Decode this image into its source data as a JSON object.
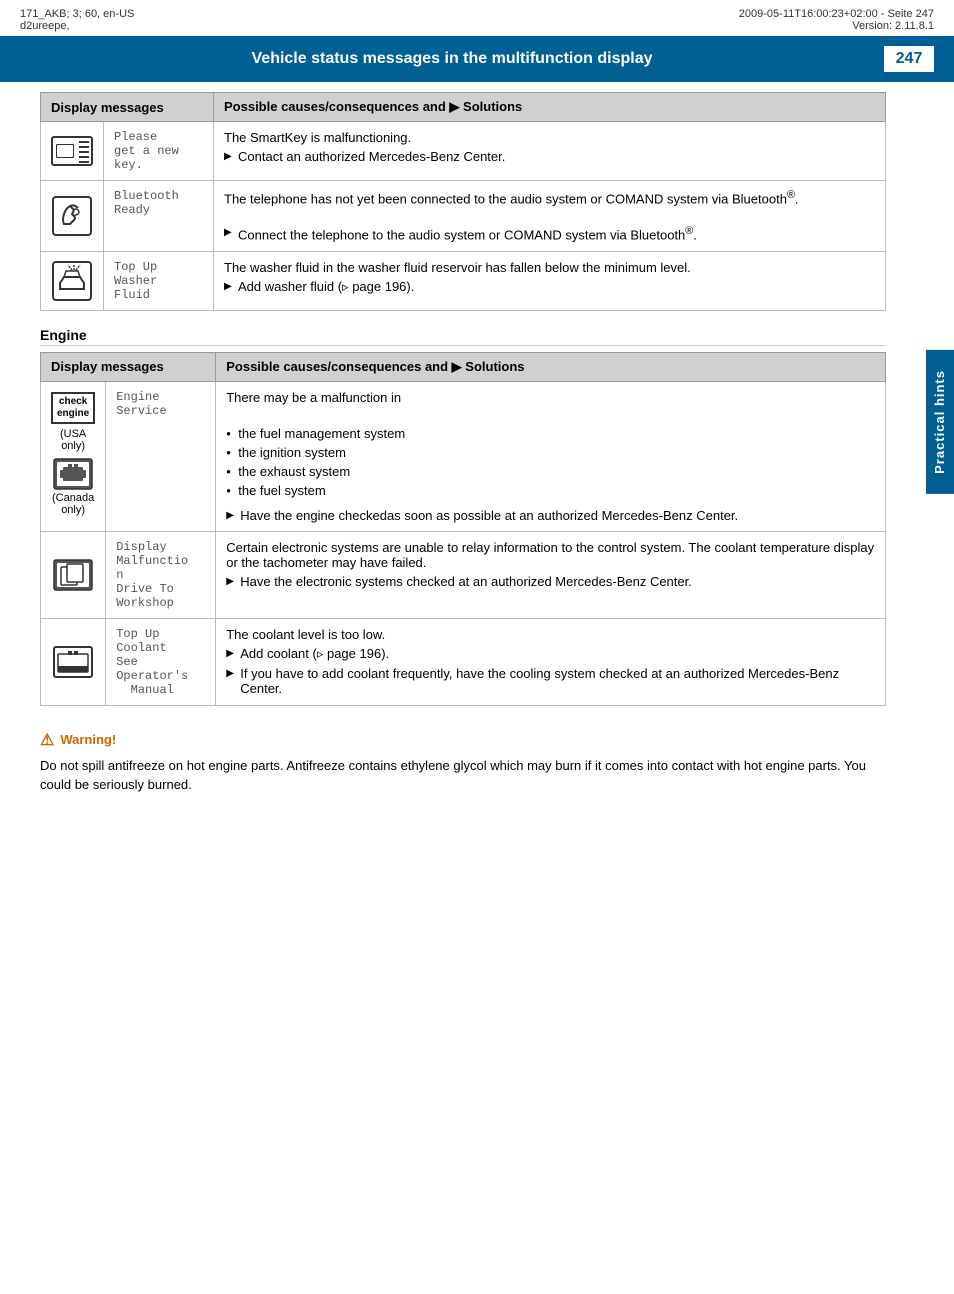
{
  "meta": {
    "left": "171_AKB; 3; 60, en-US\nd2ureepe,",
    "right": "2009-05-11T16:00:23+02:00 - Seite 247\nVersion: 2.11.8.1"
  },
  "page_title": "Vehicle status messages in the multifunction display",
  "page_number": "247",
  "right_tab_label": "Practical hints",
  "table1": {
    "header_col1": "Display messages",
    "header_col2": "Possible causes/consequences and ▶ Solutions",
    "rows": [
      {
        "display_msg": "Please\nget a new\nkey.",
        "causes": "The SmartKey is malfunctioning.\n▶ Contact an authorized Mercedes-Benz Center."
      },
      {
        "display_msg": "Bluetooth\nReady",
        "causes": "The telephone has not yet been connected to the audio system or COMAND system via Bluetooth®.\n▶ Connect the telephone to the audio system or COMAND system via Bluetooth®."
      },
      {
        "display_msg": "Top Up\nWasher\nFluid",
        "causes": "The washer fluid in the washer fluid reservoir has fallen below the minimum level.\n▶ Add washer fluid (▷ page 196)."
      }
    ]
  },
  "engine_section_heading": "Engine",
  "table2": {
    "header_col1": "Display messages",
    "header_col2": "Possible causes/consequences and ▶ Solutions",
    "rows": [
      {
        "display_msg": "Engine\nService",
        "display_sub1": "(USA only)",
        "display_sub2": "(Canada\nonly)",
        "causes_intro": "There may be a malfunction in",
        "causes_bullets": [
          "the fuel management system",
          "the ignition system",
          "the exhaust system",
          "the fuel system"
        ],
        "causes_arrow": "Have the engine checkedas soon as possible at an authorized Mercedes-Benz Center."
      },
      {
        "display_msg": "Display\nMalfunctio\nn\nDrive To\nWorkshop",
        "causes": "Certain electronic systems are unable to relay information to the control system. The coolant temperature display or the tachometer may have failed.\n▶ Have the electronic systems checked at an authorized Mercedes-Benz Center."
      },
      {
        "display_msg": "Top Up\nCoolant\nSee\nOperator's\n  Manual",
        "causes_intro": "The coolant level is too low.",
        "causes_bullets": [
          "Add coolant (▷ page 196).",
          "If you have to add coolant frequently, have the cooling system checked at an authorized Mercedes-Benz Center."
        ],
        "arrow_bullets": true
      }
    ]
  },
  "warning": {
    "title": "Warning!",
    "text": "Do not spill antifreeze on hot engine parts. Antifreeze contains ethylene glycol which may burn if it comes into contact with hot engine parts. You could be seriously burned."
  }
}
